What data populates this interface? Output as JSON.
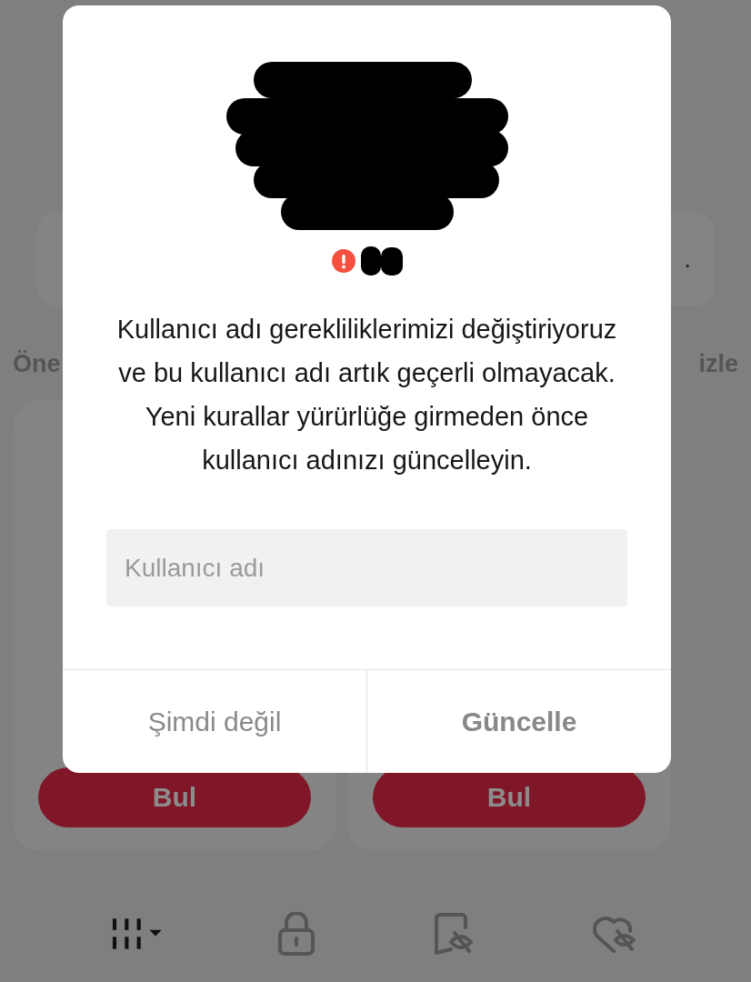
{
  "background": {
    "top_card": {
      "trailing": "."
    },
    "section_left": "Öne",
    "section_right": "izle",
    "cards": [
      {
        "button": "Bul"
      },
      {
        "button": "Bul"
      }
    ],
    "tab_bar": [
      {
        "kind": "columns"
      },
      {
        "kind": "lock"
      },
      {
        "kind": "bookmark-hidden"
      },
      {
        "kind": "heart-hidden"
      }
    ]
  },
  "dialog": {
    "message": "Kullanıcı adı gerekliliklerimizi değiştiriyoruz ve bu kullanıcı adı artık geçerli olmayacak. Yeni kurallar yürürlüğe girmeden önce kullanıcı adınızı güncelleyin.",
    "username_field": {
      "placeholder": "Kullanıcı adı"
    },
    "buttons": [
      {
        "label": "Şimdi değil",
        "kind": "cancel"
      },
      {
        "label": "Güncelle",
        "kind": "confirm",
        "disabled": true
      }
    ]
  }
}
